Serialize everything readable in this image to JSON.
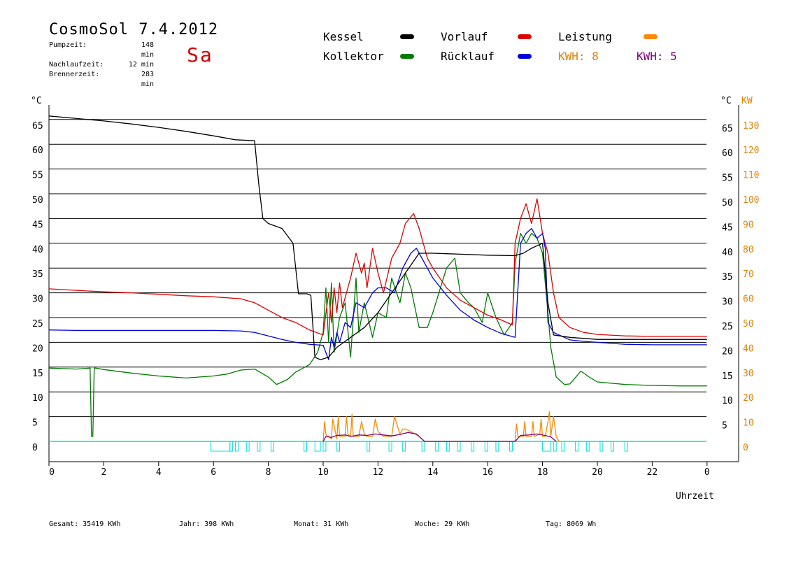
{
  "header": {
    "title": "CosmoSol 7.4.2012",
    "day": "Sa",
    "stats": [
      {
        "label": "Pumpzeit:",
        "value": "148 min"
      },
      {
        "label": "Nachlaufzeit:",
        "value": "12 min"
      },
      {
        "label": "Brennerzeit:",
        "value": "283 min"
      }
    ]
  },
  "legend": {
    "kessel": "Kessel",
    "kollektor": "Kollektor",
    "vorlauf": "Vorlauf",
    "ruecklauf": "Rücklauf",
    "leistung": "Leistung",
    "kwh1": "KWH: 8",
    "kwh2": "KWH: 5"
  },
  "colors": {
    "kessel": "#000000",
    "kollektor": "#007a00",
    "vorlauf": "#e00000",
    "ruecklauf": "#0000e0",
    "leistung": "#ff8800",
    "kwh2": "#800080",
    "pump": "#00e0e0",
    "axis_right": "#e08000"
  },
  "footer": {
    "gesamt": "Gesamt:  35419 KWh",
    "jahr": "Jahr:   398 KWh",
    "monat": "Monat:    31 KWh",
    "woche": "Woche:    29 KWh",
    "tag": "Tag:   8069 Wh"
  },
  "chart_data": {
    "type": "line",
    "xlabel": "Uhrzeit",
    "ylabel_left": "°C",
    "ylabel_right_c": "°C",
    "ylabel_right_kw": "KW",
    "xlim": [
      0,
      24
    ],
    "ylim": [
      0,
      70
    ],
    "x_ticks": [
      "0",
      "2",
      "4",
      "6",
      "8",
      "10",
      "12",
      "14",
      "16",
      "18",
      "20",
      "22",
      "0"
    ],
    "y_ticks_left": [
      "0",
      "5",
      "10",
      "15",
      "20",
      "25",
      "30",
      "35",
      "40",
      "45",
      "50",
      "55",
      "60",
      "65"
    ],
    "y_ticks_right_c": [
      "",
      "5",
      "10",
      "15",
      "20",
      "25",
      "30",
      "35",
      "40",
      "45",
      "50",
      "55",
      "60",
      "65"
    ],
    "y_ticks_right_kw": [
      "0",
      "10",
      "20",
      "30",
      "40",
      "50",
      "60",
      "70",
      "80",
      "90",
      "100",
      "110",
      "120",
      "130"
    ],
    "grid": true,
    "series": [
      {
        "name": "Kessel",
        "key": "kessel",
        "x": [
          0,
          1,
          2,
          3,
          4,
          5,
          6,
          6.8,
          7.5,
          7.65,
          7.8,
          8,
          8.5,
          8.9,
          9.1,
          9.4,
          9.55,
          9.7,
          9.9,
          10.2,
          10.5,
          11,
          11.5,
          12,
          12.5,
          13,
          13.5,
          14,
          15,
          16,
          17,
          17.3,
          17.6,
          18,
          18.2,
          18.4,
          19,
          20,
          21,
          22,
          23,
          24
        ],
        "y": [
          65.7,
          65.2,
          64.7,
          64.1,
          63.4,
          62.6,
          61.7,
          60.9,
          60.7,
          52,
          45,
          44,
          43,
          40,
          29.8,
          29.8,
          29.5,
          17,
          16.5,
          17,
          19,
          21,
          23,
          26,
          30,
          34,
          38,
          38,
          37.8,
          37.6,
          37.5,
          38,
          39,
          40,
          28,
          21.5,
          21,
          20.6,
          20.6,
          20.6,
          20.6,
          20.6
        ]
      },
      {
        "name": "Vorlauf",
        "key": "vorlauf",
        "x": [
          0,
          1,
          2,
          3,
          4,
          5,
          6,
          7,
          7.5,
          8,
          8.5,
          9,
          9.5,
          10,
          10.2,
          10.3,
          10.4,
          10.5,
          10.6,
          10.7,
          10.8,
          11,
          11.2,
          11.4,
          11.5,
          11.6,
          11.8,
          12,
          12.2,
          12.5,
          12.8,
          13,
          13.3,
          13.5,
          13.8,
          14,
          14.5,
          15,
          15.5,
          16,
          16.5,
          16.9,
          17,
          17.2,
          17.4,
          17.6,
          17.8,
          18,
          18.2,
          18.4,
          18.6,
          19,
          19.5,
          20,
          21,
          22,
          23,
          24
        ],
        "y": [
          30.8,
          30.5,
          30.2,
          30,
          29.7,
          29.4,
          29.2,
          28.8,
          28,
          26.5,
          25,
          24,
          22.5,
          21.5,
          30,
          24,
          31,
          26,
          32,
          27,
          29,
          33,
          38,
          34,
          36,
          31,
          39,
          34,
          30,
          37,
          40,
          44,
          46,
          43,
          37,
          35,
          31,
          28.5,
          27,
          25.5,
          24.5,
          23.5,
          40,
          45,
          48,
          44,
          49,
          42,
          38,
          30,
          25,
          23,
          22,
          21.6,
          21.3,
          21.2,
          21.2,
          21.2
        ]
      },
      {
        "name": "Rücklauf",
        "key": "ruecklauf",
        "x": [
          0,
          1,
          2,
          3,
          4,
          5,
          6,
          7,
          7.5,
          8,
          8.5,
          9,
          9.5,
          10,
          10.2,
          10.3,
          10.4,
          10.5,
          10.6,
          10.8,
          11,
          11.2,
          11.5,
          11.8,
          12,
          12.3,
          12.6,
          12.9,
          13.2,
          13.4,
          13.6,
          14,
          14.5,
          15,
          15.5,
          16,
          16.5,
          17,
          17.2,
          17.4,
          17.6,
          17.8,
          18,
          18.1,
          18.2,
          18.4,
          18.6,
          19,
          19.5,
          20,
          21,
          22,
          23,
          24
        ],
        "y": [
          22.5,
          22.4,
          22.4,
          22.4,
          22.4,
          22.4,
          22.4,
          22.3,
          22,
          21.3,
          20.6,
          20,
          19.6,
          19.4,
          16.5,
          21,
          19,
          22,
          20,
          24,
          23,
          28,
          27,
          30,
          31,
          31,
          30,
          35,
          38,
          39,
          37,
          33,
          29.5,
          26.5,
          24.5,
          23,
          21.8,
          21,
          40,
          42,
          43,
          41,
          42,
          39,
          24,
          22,
          21.5,
          20.5,
          20.2,
          20,
          19.6,
          19.5,
          19.5,
          19.5
        ]
      },
      {
        "name": "Kollektor",
        "key": "kollektor",
        "x": [
          0,
          0.5,
          1,
          1.5,
          1.55,
          1.6,
          1.65,
          1.7,
          2,
          3,
          4,
          5,
          6,
          6.5,
          7,
          7.5,
          8,
          8.3,
          8.7,
          9,
          9.5,
          9.8,
          10,
          10.1,
          10.2,
          10.3,
          10.4,
          10.6,
          10.8,
          11,
          11.2,
          11.3,
          11.5,
          11.8,
          12,
          12.3,
          12.5,
          12.8,
          13,
          13.2,
          13.5,
          13.8,
          14,
          14.5,
          14.8,
          15,
          15.3,
          15.5,
          15.8,
          16,
          16.3,
          16.6,
          16.9,
          17,
          17.2,
          17.4,
          17.6,
          17.8,
          18,
          18.2,
          18.3,
          18.5,
          18.8,
          19,
          19.4,
          19.7,
          20,
          21,
          22,
          23,
          24
        ],
        "y": [
          14.8,
          14.7,
          14.6,
          14.8,
          1,
          1,
          14.8,
          14.8,
          14.5,
          13.8,
          13.2,
          12.8,
          13.2,
          13.6,
          14.4,
          14.6,
          13,
          11.5,
          12.5,
          14,
          15.5,
          18,
          22,
          31,
          20,
          32,
          18,
          25,
          28,
          17,
          33,
          22,
          28,
          21,
          26,
          25,
          33,
          28,
          34,
          31,
          23,
          23,
          26,
          35,
          37,
          30,
          28,
          27,
          24,
          30,
          25,
          21.5,
          24,
          36,
          42,
          40,
          42,
          41,
          38,
          26,
          19,
          13,
          11.5,
          11.6,
          14.2,
          13,
          12,
          11.5,
          11.3,
          11.2,
          11.2
        ]
      },
      {
        "name": "Leistung",
        "key": "leistung",
        "x": [
          10,
          10.05,
          10.1,
          10.15,
          10.2,
          10.3,
          10.35,
          10.5,
          10.55,
          10.6,
          10.8,
          10.85,
          10.9,
          11,
          11.05,
          11.1,
          11.3,
          11.4,
          11.5,
          11.6,
          11.8,
          11.9,
          12,
          12.1,
          12.2,
          12.5,
          12.6,
          12.8,
          12.9,
          13,
          13.2,
          13.5,
          13.7,
          17,
          17.05,
          17.1,
          17.3,
          17.35,
          17.4,
          17.6,
          17.65,
          17.7,
          17.9,
          17.95,
          18,
          18.1,
          18.2,
          18.25,
          18.3,
          18.4,
          18.5,
          18.6
        ],
        "y": [
          0,
          4,
          1.5,
          1,
          1,
          0.5,
          4.5,
          0.5,
          5,
          1,
          1,
          5,
          1.5,
          1,
          5.5,
          1,
          1,
          4,
          1.5,
          1,
          1,
          4.5,
          2,
          1.5,
          1,
          1,
          5,
          1.5,
          2.5,
          2.5,
          2,
          1,
          0,
          0,
          3.5,
          1,
          1,
          4,
          1,
          1,
          4,
          1,
          1.5,
          4.5,
          1,
          1,
          4,
          6,
          1,
          5,
          1,
          0
        ]
      },
      {
        "name": "KWH 5",
        "key": "kwh2",
        "x": [
          10,
          10.1,
          10.3,
          10.5,
          10.8,
          11,
          11.3,
          11.6,
          11.9,
          12.2,
          12.5,
          12.8,
          13.1,
          13.4,
          13.7,
          17,
          17.2,
          17.5,
          17.8,
          18.1,
          18.3,
          18.5
        ],
        "y": [
          0,
          1,
          0.8,
          1.2,
          1.3,
          1,
          1.3,
          1.2,
          1.5,
          1.3,
          1.1,
          1.4,
          1.8,
          1.5,
          0,
          0,
          1.2,
          1.3,
          1.5,
          1.2,
          0.9,
          0
        ]
      }
    ],
    "pump_segments": [
      [
        5.9,
        6.6
      ],
      [
        6.6,
        6.7
      ],
      [
        6.8,
        6.9
      ],
      [
        7.2,
        7.3
      ],
      [
        7.6,
        7.7
      ],
      [
        8.1,
        8.2
      ],
      [
        9.3,
        9.4
      ],
      [
        9.7,
        9.9
      ],
      [
        10,
        10.1
      ],
      [
        10.5,
        10.6
      ],
      [
        11.6,
        11.7
      ],
      [
        12.4,
        12.5
      ],
      [
        12.9,
        13
      ],
      [
        13.6,
        13.7
      ],
      [
        14.1,
        14.2
      ],
      [
        14.5,
        14.6
      ],
      [
        14.9,
        15
      ],
      [
        15.4,
        15.5
      ],
      [
        15.9,
        16
      ],
      [
        16.3,
        16.4
      ],
      [
        16.8,
        16.9
      ],
      [
        18,
        18.3
      ],
      [
        18.4,
        18.5
      ],
      [
        18.7,
        18.8
      ],
      [
        19.2,
        19.3
      ],
      [
        19.6,
        19.7
      ],
      [
        20.1,
        20.2
      ],
      [
        20.5,
        20.6
      ],
      [
        21,
        21.1
      ]
    ]
  }
}
